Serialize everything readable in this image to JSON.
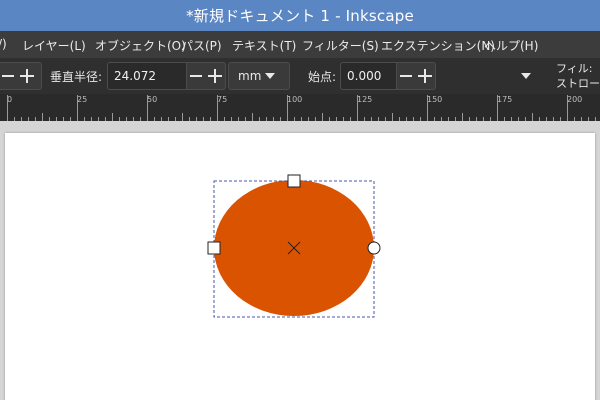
{
  "window": {
    "title": "*新規ドキュメント 1 - Inkscape"
  },
  "menubar": {
    "items": [
      {
        "label": "/)"
      },
      {
        "label": "レイヤー(L)"
      },
      {
        "label": "オブジェクト(O)"
      },
      {
        "label": "パス(P)"
      },
      {
        "label": "テキスト(T)"
      },
      {
        "label": "フィルター(S)"
      },
      {
        "label": "エクステンション(N)"
      },
      {
        "label": "ヘルプ(H)"
      }
    ]
  },
  "toolbar": {
    "ry_label": "垂直半径:",
    "ry_value": "24.072",
    "unit": "mm",
    "start_label": "始点:",
    "start_value": "0.000",
    "fill_label": "フィル:",
    "stroke_label": "ストローク:"
  },
  "ruler": {
    "labels": [
      "0",
      "25",
      "50",
      "75",
      "100",
      "125",
      "150",
      "175",
      "200"
    ]
  },
  "colors": {
    "ellipse_fill": "#d95300",
    "selection_dash": "#4a55a8"
  },
  "icons": [
    "minus-icon",
    "plus-icon",
    "dropdown-triangle-icon",
    "center-x-icon"
  ]
}
